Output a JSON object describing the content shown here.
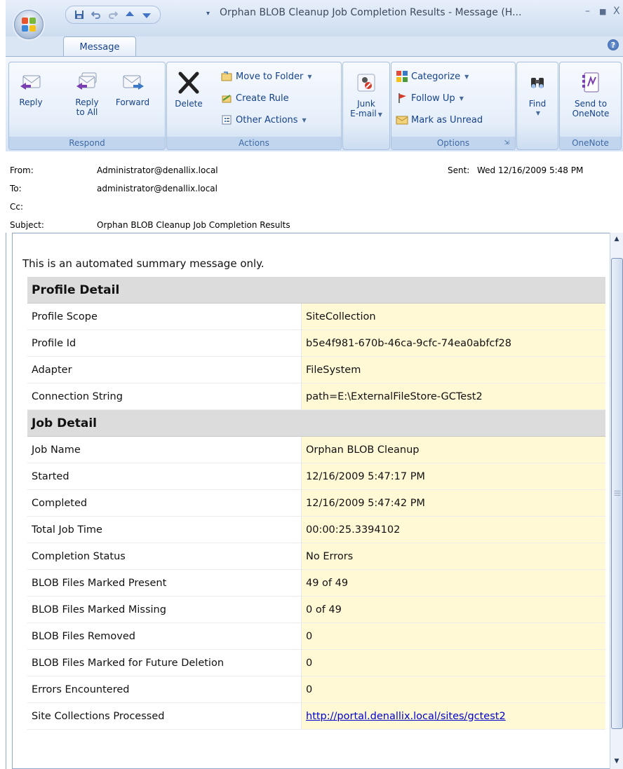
{
  "window": {
    "title": "Orphan BLOB Cleanup Job Completion Results - Message (H...",
    "controls": [
      "–",
      "■",
      "X"
    ]
  },
  "quick_access": {
    "icons": [
      "save-icon",
      "undo-icon",
      "redo-icon",
      "up-arrow-icon",
      "down-arrow-icon"
    ],
    "dropdown": "▾"
  },
  "ribbon": {
    "tab": "Message",
    "help": "?",
    "groups": {
      "respond": {
        "label": "Respond",
        "reply": "Reply",
        "reply_all_1": "Reply",
        "reply_all_2": "to All",
        "forward": "Forward"
      },
      "actions": {
        "label": "Actions",
        "delete": "Delete",
        "move_to_folder": "Move to Folder",
        "create_rule": "Create Rule",
        "other_actions": "Other Actions"
      },
      "junk": {
        "line1": "Junk",
        "line2": "E-mail"
      },
      "options": {
        "label": "Options",
        "categorize": "Categorize",
        "follow_up": "Follow Up",
        "mark_unread": "Mark as Unread"
      },
      "find": {
        "label": "Find"
      },
      "onenote": {
        "label": "OneNote",
        "send_1": "Send to",
        "send_2": "OneNote"
      }
    }
  },
  "header": {
    "from_label": "From:",
    "from": "Administrator@denallix.local",
    "to_label": "To:",
    "to": "administrator@denallix.local",
    "cc_label": "Cc:",
    "cc": "",
    "subject_label": "Subject:",
    "subject": "Orphan BLOB Cleanup Job Completion Results",
    "sent_label": "Sent:",
    "sent": "Wed 12/16/2009 5:48 PM"
  },
  "body": {
    "intro": "This is an automated summary message only.",
    "sections": [
      {
        "title": "Profile Detail",
        "rows": [
          {
            "k": "Profile Scope",
            "v": "SiteCollection"
          },
          {
            "k": "Profile Id",
            "v": "b5e4f981-670b-46ca-9cfc-74ea0abfcf28"
          },
          {
            "k": "Adapter",
            "v": "FileSystem"
          },
          {
            "k": "Connection String",
            "v": "path=E:\\ExternalFileStore-GCTest2"
          }
        ]
      },
      {
        "title": "Job Detail",
        "rows": [
          {
            "k": "Job Name",
            "v": "Orphan BLOB Cleanup"
          },
          {
            "k": "Started",
            "v": "12/16/2009 5:47:17 PM"
          },
          {
            "k": "Completed",
            "v": "12/16/2009 5:47:42 PM"
          },
          {
            "k": "Total Job Time",
            "v": "00:00:25.3394102"
          },
          {
            "k": "Completion Status",
            "v": "No Errors"
          },
          {
            "k": "BLOB Files Marked Present",
            "v": "49 of 49"
          },
          {
            "k": "BLOB Files Marked Missing",
            "v": "0 of 49"
          },
          {
            "k": "BLOB Files Removed",
            "v": "0"
          },
          {
            "k": "BLOB Files Marked for Future Deletion",
            "v": "0"
          },
          {
            "k": "Errors Encountered",
            "v": "0"
          },
          {
            "k": "Site Collections Processed",
            "v": "http://portal.denallix.local/sites/gctest2",
            "link": true
          }
        ]
      }
    ]
  },
  "colors": {
    "value_cell": "#fff9d6",
    "section_header": "#dcdcdc",
    "ribbon_text": "#15428b",
    "link": "#0000cc"
  }
}
